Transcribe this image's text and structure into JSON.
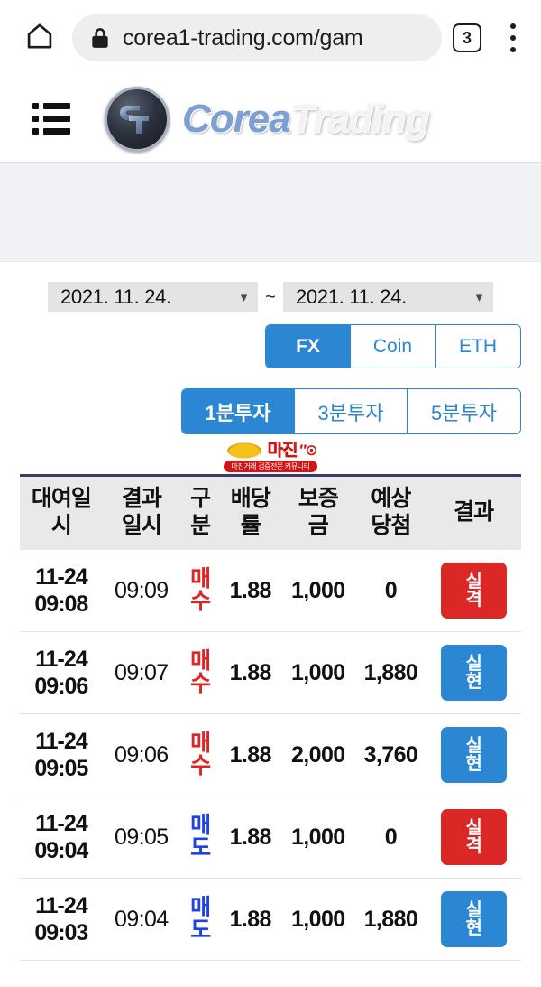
{
  "browser": {
    "home_icon": "home-icon",
    "lock_icon": "lock-icon",
    "url": "corea1-trading.com/gam",
    "tab_count": "3",
    "menu_icon": "kebab-menu-icon"
  },
  "site_header": {
    "menu_icon": "hamburger-menu-icon",
    "logo_icon": "ct-logo-icon",
    "brand_first": "Corea",
    "brand_second": "Trading"
  },
  "filters": {
    "date_from": "2021. 11. 24.",
    "date_to": "2021. 11. 24.",
    "separator": "~",
    "chevron": "⌄",
    "market_tabs": [
      {
        "label": "FX",
        "active": true
      },
      {
        "label": "Coin",
        "active": false
      },
      {
        "label": "ETH",
        "active": false
      }
    ],
    "interval_tabs": [
      {
        "label": "1분투자",
        "active": true
      },
      {
        "label": "3분투자",
        "active": false
      },
      {
        "label": "5분투자",
        "active": false
      }
    ]
  },
  "ad_banner": {
    "title": "마진",
    "glyph": "″⊙",
    "subtitle": "마진거래 검증전문 커뮤니티"
  },
  "table": {
    "headers": [
      {
        "line1": "대여일",
        "line2": "시"
      },
      {
        "line1": "결과",
        "line2": "일시"
      },
      {
        "line1": "구",
        "line2": "분"
      },
      {
        "line1": "배당",
        "line2": "률"
      },
      {
        "line1": "보증",
        "line2": "금"
      },
      {
        "line1": "예상",
        "line2": "당첨"
      },
      {
        "line1": "결과",
        "line2": ""
      }
    ],
    "rows": [
      {
        "lend_date": "11-24",
        "lend_time": "09:08",
        "result_time": "09:09",
        "type_l1": "매",
        "type_l2": "수",
        "type_side": "buy",
        "rate": "1.88",
        "deposit": "1,000",
        "expected": "0",
        "status_l1": "실",
        "status_l2": "격",
        "status_kind": "fail"
      },
      {
        "lend_date": "11-24",
        "lend_time": "09:06",
        "result_time": "09:07",
        "type_l1": "매",
        "type_l2": "수",
        "type_side": "buy",
        "rate": "1.88",
        "deposit": "1,000",
        "expected": "1,880",
        "status_l1": "실",
        "status_l2": "현",
        "status_kind": "win"
      },
      {
        "lend_date": "11-24",
        "lend_time": "09:05",
        "result_time": "09:06",
        "type_l1": "매",
        "type_l2": "수",
        "type_side": "buy",
        "rate": "1.88",
        "deposit": "2,000",
        "expected": "3,760",
        "status_l1": "실",
        "status_l2": "현",
        "status_kind": "win"
      },
      {
        "lend_date": "11-24",
        "lend_time": "09:04",
        "result_time": "09:05",
        "type_l1": "매",
        "type_l2": "도",
        "type_side": "sell",
        "rate": "1.88",
        "deposit": "1,000",
        "expected": "0",
        "status_l1": "실",
        "status_l2": "격",
        "status_kind": "fail"
      },
      {
        "lend_date": "11-24",
        "lend_time": "09:03",
        "result_time": "09:04",
        "type_l1": "매",
        "type_l2": "도",
        "type_side": "sell",
        "rate": "1.88",
        "deposit": "1,000",
        "expected": "1,880",
        "status_l1": "실",
        "status_l2": "현",
        "status_kind": "win"
      }
    ]
  },
  "colors": {
    "accent_blue": "#2b87d3",
    "badge_fail": "#dc2727",
    "badge_win": "#2b87d3",
    "buy_red": "#e32222",
    "sell_blue": "#1d43e6",
    "table_header_bg": "#e9e9e9",
    "table_top_rule": "#3f3a68"
  }
}
